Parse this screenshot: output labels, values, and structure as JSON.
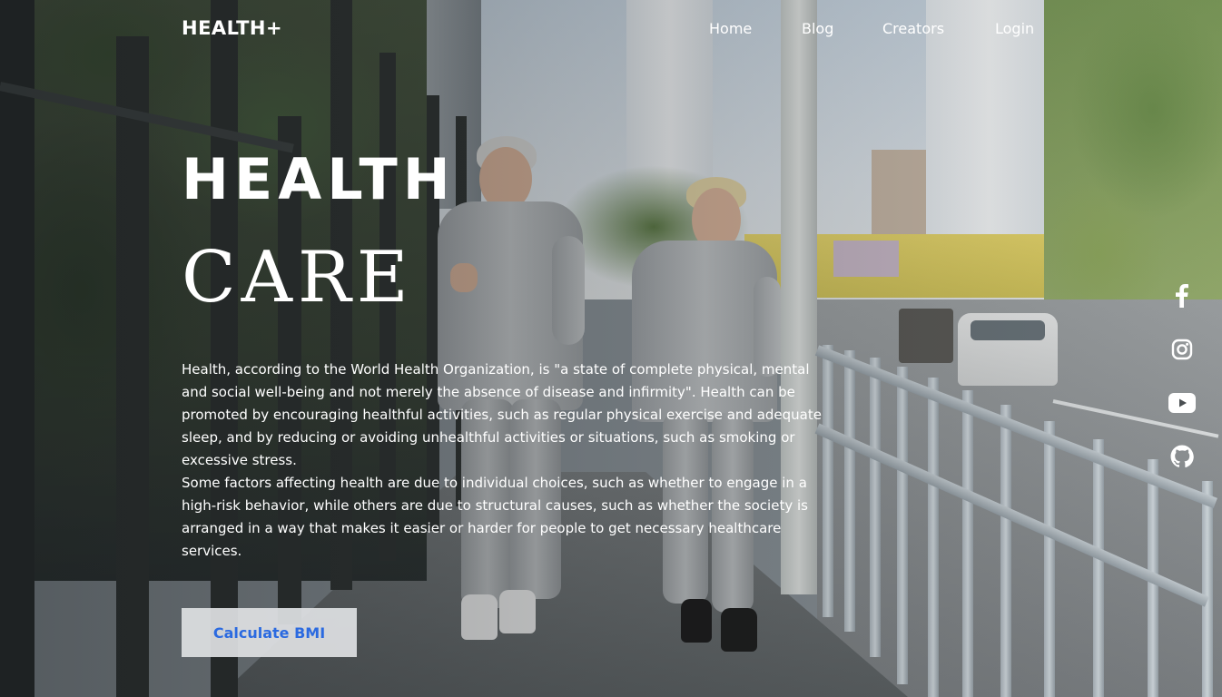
{
  "brand": {
    "name": "HEALTH+"
  },
  "nav": {
    "items": [
      {
        "label": "Home"
      },
      {
        "label": "Blog"
      },
      {
        "label": "Creators"
      },
      {
        "label": "Login"
      }
    ]
  },
  "hero": {
    "title_line1": "HEALTH",
    "title_line2": "CARE",
    "paragraph1": "Health, according to the World Health Organization, is \"a state of complete physical, mental and social well-being and not merely the absence of disease and infirmity\". Health can be promoted by encouraging healthful activities, such as regular physical exercise and adequate sleep, and by reducing or avoiding unhealthful activities or situations, such as smoking or excessive stress.",
    "paragraph2": "Some factors affecting health are due to individual choices, such as whether to engage in a high-risk behavior, while others are due to structural causes, such as whether the society is arranged in a way that makes it easier or harder for people to get necessary healthcare services.",
    "cta_label": "Calculate BMI"
  },
  "social": {
    "icons": [
      "facebook-icon",
      "instagram-icon",
      "youtube-icon",
      "github-icon"
    ]
  },
  "colors": {
    "text": "#ffffff",
    "cta_text": "#2b6ae0",
    "cta_bg": "#dedfe1"
  }
}
